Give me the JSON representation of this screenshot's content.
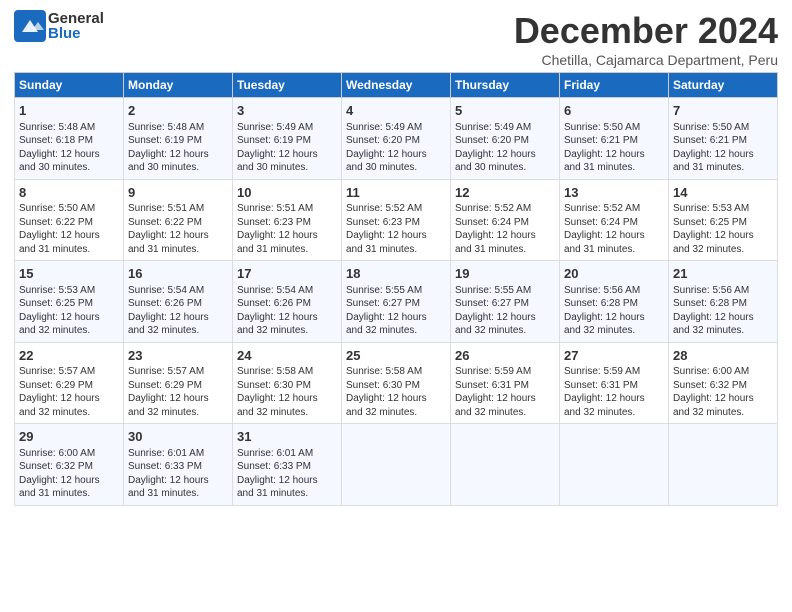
{
  "logo": {
    "general": "General",
    "blue": "Blue"
  },
  "title": "December 2024",
  "subtitle": "Chetilla, Cajamarca Department, Peru",
  "columns": [
    "Sunday",
    "Monday",
    "Tuesday",
    "Wednesday",
    "Thursday",
    "Friday",
    "Saturday"
  ],
  "weeks": [
    [
      {
        "day": "1",
        "sunrise": "Sunrise: 5:48 AM",
        "sunset": "Sunset: 6:18 PM",
        "daylight": "Daylight: 12 hours and 30 minutes."
      },
      {
        "day": "2",
        "sunrise": "Sunrise: 5:48 AM",
        "sunset": "Sunset: 6:19 PM",
        "daylight": "Daylight: 12 hours and 30 minutes."
      },
      {
        "day": "3",
        "sunrise": "Sunrise: 5:49 AM",
        "sunset": "Sunset: 6:19 PM",
        "daylight": "Daylight: 12 hours and 30 minutes."
      },
      {
        "day": "4",
        "sunrise": "Sunrise: 5:49 AM",
        "sunset": "Sunset: 6:20 PM",
        "daylight": "Daylight: 12 hours and 30 minutes."
      },
      {
        "day": "5",
        "sunrise": "Sunrise: 5:49 AM",
        "sunset": "Sunset: 6:20 PM",
        "daylight": "Daylight: 12 hours and 30 minutes."
      },
      {
        "day": "6",
        "sunrise": "Sunrise: 5:50 AM",
        "sunset": "Sunset: 6:21 PM",
        "daylight": "Daylight: 12 hours and 31 minutes."
      },
      {
        "day": "7",
        "sunrise": "Sunrise: 5:50 AM",
        "sunset": "Sunset: 6:21 PM",
        "daylight": "Daylight: 12 hours and 31 minutes."
      }
    ],
    [
      {
        "day": "8",
        "sunrise": "Sunrise: 5:50 AM",
        "sunset": "Sunset: 6:22 PM",
        "daylight": "Daylight: 12 hours and 31 minutes."
      },
      {
        "day": "9",
        "sunrise": "Sunrise: 5:51 AM",
        "sunset": "Sunset: 6:22 PM",
        "daylight": "Daylight: 12 hours and 31 minutes."
      },
      {
        "day": "10",
        "sunrise": "Sunrise: 5:51 AM",
        "sunset": "Sunset: 6:23 PM",
        "daylight": "Daylight: 12 hours and 31 minutes."
      },
      {
        "day": "11",
        "sunrise": "Sunrise: 5:52 AM",
        "sunset": "Sunset: 6:23 PM",
        "daylight": "Daylight: 12 hours and 31 minutes."
      },
      {
        "day": "12",
        "sunrise": "Sunrise: 5:52 AM",
        "sunset": "Sunset: 6:24 PM",
        "daylight": "Daylight: 12 hours and 31 minutes."
      },
      {
        "day": "13",
        "sunrise": "Sunrise: 5:52 AM",
        "sunset": "Sunset: 6:24 PM",
        "daylight": "Daylight: 12 hours and 31 minutes."
      },
      {
        "day": "14",
        "sunrise": "Sunrise: 5:53 AM",
        "sunset": "Sunset: 6:25 PM",
        "daylight": "Daylight: 12 hours and 32 minutes."
      }
    ],
    [
      {
        "day": "15",
        "sunrise": "Sunrise: 5:53 AM",
        "sunset": "Sunset: 6:25 PM",
        "daylight": "Daylight: 12 hours and 32 minutes."
      },
      {
        "day": "16",
        "sunrise": "Sunrise: 5:54 AM",
        "sunset": "Sunset: 6:26 PM",
        "daylight": "Daylight: 12 hours and 32 minutes."
      },
      {
        "day": "17",
        "sunrise": "Sunrise: 5:54 AM",
        "sunset": "Sunset: 6:26 PM",
        "daylight": "Daylight: 12 hours and 32 minutes."
      },
      {
        "day": "18",
        "sunrise": "Sunrise: 5:55 AM",
        "sunset": "Sunset: 6:27 PM",
        "daylight": "Daylight: 12 hours and 32 minutes."
      },
      {
        "day": "19",
        "sunrise": "Sunrise: 5:55 AM",
        "sunset": "Sunset: 6:27 PM",
        "daylight": "Daylight: 12 hours and 32 minutes."
      },
      {
        "day": "20",
        "sunrise": "Sunrise: 5:56 AM",
        "sunset": "Sunset: 6:28 PM",
        "daylight": "Daylight: 12 hours and 32 minutes."
      },
      {
        "day": "21",
        "sunrise": "Sunrise: 5:56 AM",
        "sunset": "Sunset: 6:28 PM",
        "daylight": "Daylight: 12 hours and 32 minutes."
      }
    ],
    [
      {
        "day": "22",
        "sunrise": "Sunrise: 5:57 AM",
        "sunset": "Sunset: 6:29 PM",
        "daylight": "Daylight: 12 hours and 32 minutes."
      },
      {
        "day": "23",
        "sunrise": "Sunrise: 5:57 AM",
        "sunset": "Sunset: 6:29 PM",
        "daylight": "Daylight: 12 hours and 32 minutes."
      },
      {
        "day": "24",
        "sunrise": "Sunrise: 5:58 AM",
        "sunset": "Sunset: 6:30 PM",
        "daylight": "Daylight: 12 hours and 32 minutes."
      },
      {
        "day": "25",
        "sunrise": "Sunrise: 5:58 AM",
        "sunset": "Sunset: 6:30 PM",
        "daylight": "Daylight: 12 hours and 32 minutes."
      },
      {
        "day": "26",
        "sunrise": "Sunrise: 5:59 AM",
        "sunset": "Sunset: 6:31 PM",
        "daylight": "Daylight: 12 hours and 32 minutes."
      },
      {
        "day": "27",
        "sunrise": "Sunrise: 5:59 AM",
        "sunset": "Sunset: 6:31 PM",
        "daylight": "Daylight: 12 hours and 32 minutes."
      },
      {
        "day": "28",
        "sunrise": "Sunrise: 6:00 AM",
        "sunset": "Sunset: 6:32 PM",
        "daylight": "Daylight: 12 hours and 32 minutes."
      }
    ],
    [
      {
        "day": "29",
        "sunrise": "Sunrise: 6:00 AM",
        "sunset": "Sunset: 6:32 PM",
        "daylight": "Daylight: 12 hours and 31 minutes."
      },
      {
        "day": "30",
        "sunrise": "Sunrise: 6:01 AM",
        "sunset": "Sunset: 6:33 PM",
        "daylight": "Daylight: 12 hours and 31 minutes."
      },
      {
        "day": "31",
        "sunrise": "Sunrise: 6:01 AM",
        "sunset": "Sunset: 6:33 PM",
        "daylight": "Daylight: 12 hours and 31 minutes."
      },
      {
        "day": "",
        "sunrise": "",
        "sunset": "",
        "daylight": ""
      },
      {
        "day": "",
        "sunrise": "",
        "sunset": "",
        "daylight": ""
      },
      {
        "day": "",
        "sunrise": "",
        "sunset": "",
        "daylight": ""
      },
      {
        "day": "",
        "sunrise": "",
        "sunset": "",
        "daylight": ""
      }
    ]
  ]
}
